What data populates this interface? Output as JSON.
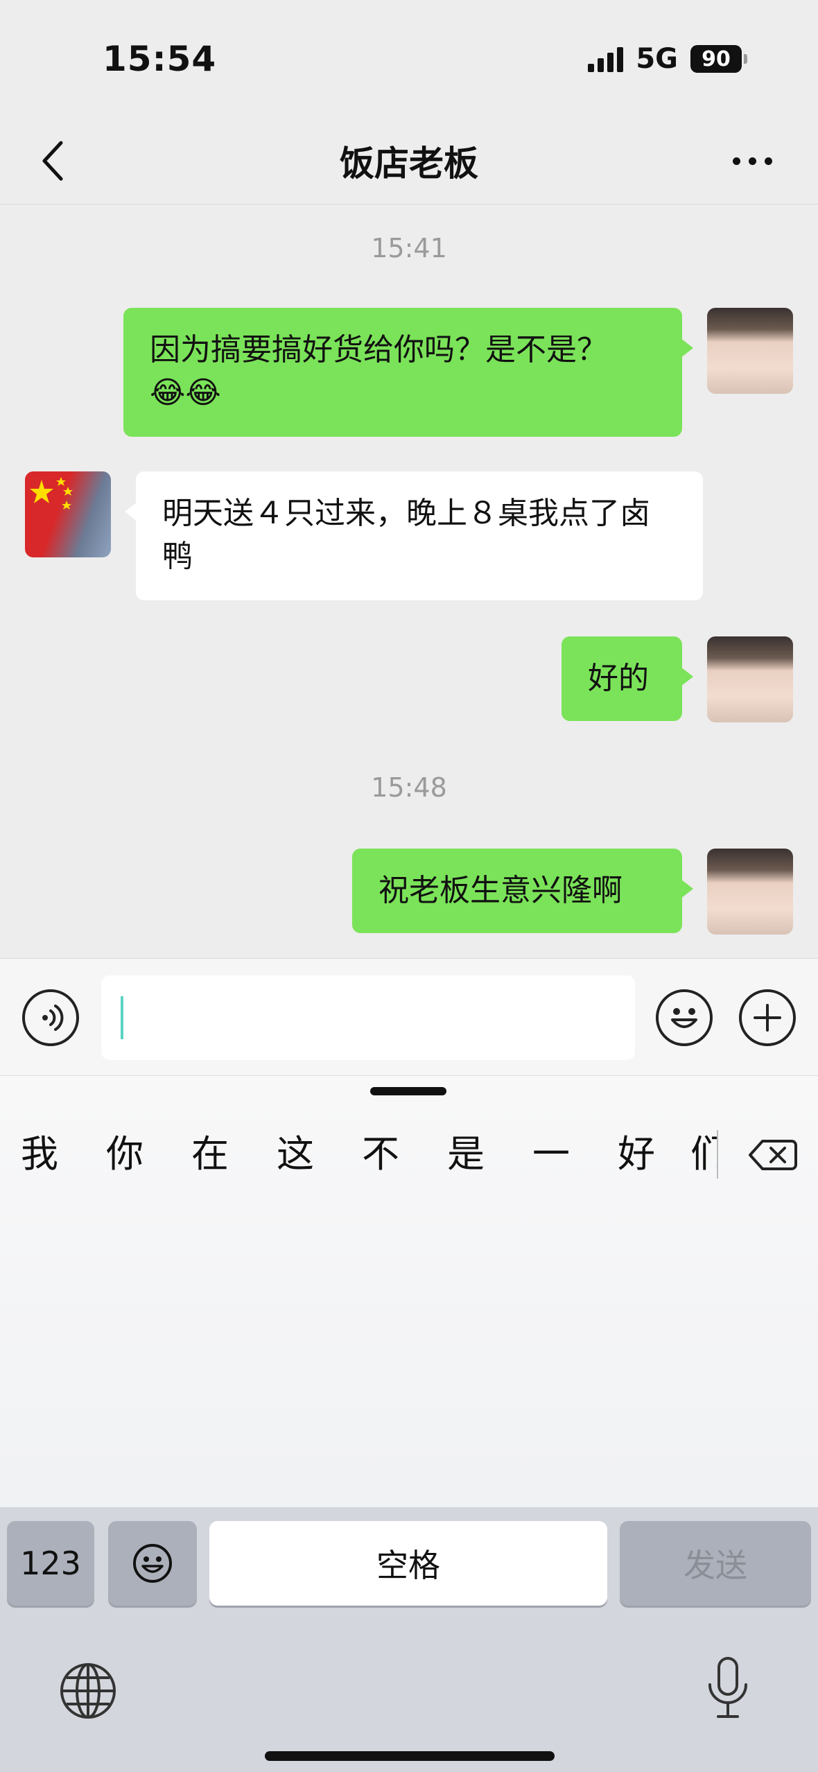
{
  "status_bar": {
    "time": "15:54",
    "network": "5G",
    "battery": "90"
  },
  "nav": {
    "title": "饭店老板"
  },
  "chat": {
    "timestamps": [
      "15:41",
      "15:48"
    ],
    "messages": [
      {
        "side": "sent",
        "text_line1": "因为搞要搞好货给你吗？是不是？",
        "emoji": "😂😂"
      },
      {
        "side": "received",
        "text": "明天送４只过来，晚上８桌我点了卤鸭"
      },
      {
        "side": "sent",
        "text": "好的"
      },
      {
        "side": "sent",
        "text": "祝老板生意兴隆啊"
      }
    ]
  },
  "input": {
    "value": ""
  },
  "keyboard": {
    "candidates": [
      "我",
      "你",
      "在",
      "这",
      "不",
      "是",
      "一",
      "好",
      "们"
    ],
    "numbers_key": "123",
    "space_key": "空格",
    "send_key": "发送"
  },
  "icons": [
    "back-icon",
    "more-icon",
    "voice-icon",
    "emoji-icon",
    "plus-icon",
    "delete-icon",
    "globe-icon",
    "mic-icon"
  ],
  "colors": {
    "sent_bubble": "#7be359",
    "received_bubble": "#ffffff",
    "background": "#ededed"
  }
}
